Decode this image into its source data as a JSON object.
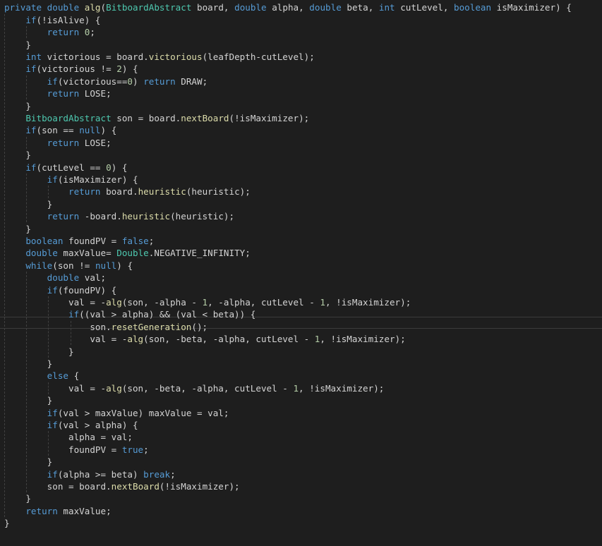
{
  "editor": {
    "language": "java",
    "colors": {
      "background": "#1e1e1e",
      "keyword": "#569cd6",
      "type": "#4ec9b0",
      "function": "#dcdcaa",
      "number": "#b5cea8",
      "text": "#d4d4d4"
    },
    "lines": [
      [
        [
          "kw",
          "private"
        ],
        [
          "t",
          " "
        ],
        [
          "kw",
          "double"
        ],
        [
          "t",
          " "
        ],
        [
          "fn",
          "alg"
        ],
        [
          "t",
          "("
        ],
        [
          "type",
          "BitboardAbstract"
        ],
        [
          "t",
          " board, "
        ],
        [
          "kw",
          "double"
        ],
        [
          "t",
          " alpha, "
        ],
        [
          "kw",
          "double"
        ],
        [
          "t",
          " beta, "
        ],
        [
          "kw",
          "int"
        ],
        [
          "t",
          " cutLevel, "
        ],
        [
          "kw",
          "boolean"
        ],
        [
          "t",
          " isMaximizer) {"
        ]
      ],
      [
        [
          "t",
          "    "
        ],
        [
          "kw",
          "if"
        ],
        [
          "t",
          "(!isAlive) {"
        ]
      ],
      [
        [
          "t",
          "        "
        ],
        [
          "kw",
          "return"
        ],
        [
          "t",
          " "
        ],
        [
          "num",
          "0"
        ],
        [
          "t",
          ";"
        ]
      ],
      [
        [
          "t",
          "    }"
        ]
      ],
      [
        [
          "t",
          "    "
        ],
        [
          "kw",
          "int"
        ],
        [
          "t",
          " victorious = board."
        ],
        [
          "fn",
          "victorious"
        ],
        [
          "t",
          "(leafDepth-cutLevel);"
        ]
      ],
      [
        [
          "t",
          "    "
        ],
        [
          "kw",
          "if"
        ],
        [
          "t",
          "(victorious != "
        ],
        [
          "num",
          "2"
        ],
        [
          "t",
          ") {"
        ]
      ],
      [
        [
          "t",
          "        "
        ],
        [
          "kw",
          "if"
        ],
        [
          "t",
          "(victorious=="
        ],
        [
          "num",
          "0"
        ],
        [
          "t",
          ") "
        ],
        [
          "kw",
          "return"
        ],
        [
          "t",
          " DRAW;"
        ]
      ],
      [
        [
          "t",
          "        "
        ],
        [
          "kw",
          "return"
        ],
        [
          "t",
          " LOSE;"
        ]
      ],
      [
        [
          "t",
          "    }"
        ]
      ],
      [
        [
          "t",
          "    "
        ],
        [
          "type",
          "BitboardAbstract"
        ],
        [
          "t",
          " son = board."
        ],
        [
          "fn",
          "nextBoard"
        ],
        [
          "t",
          "(!isMaximizer);"
        ]
      ],
      [
        [
          "t",
          "    "
        ],
        [
          "kw",
          "if"
        ],
        [
          "t",
          "(son == "
        ],
        [
          "kw",
          "null"
        ],
        [
          "t",
          ") {"
        ]
      ],
      [
        [
          "t",
          "        "
        ],
        [
          "kw",
          "return"
        ],
        [
          "t",
          " LOSE;"
        ]
      ],
      [
        [
          "t",
          "    }"
        ]
      ],
      [
        [
          "t",
          "    "
        ],
        [
          "kw",
          "if"
        ],
        [
          "t",
          "(cutLevel == "
        ],
        [
          "num",
          "0"
        ],
        [
          "t",
          ") {"
        ]
      ],
      [
        [
          "t",
          "        "
        ],
        [
          "kw",
          "if"
        ],
        [
          "t",
          "(isMaximizer) {"
        ]
      ],
      [
        [
          "t",
          "            "
        ],
        [
          "kw",
          "return"
        ],
        [
          "t",
          " board."
        ],
        [
          "fn",
          "heuristic"
        ],
        [
          "t",
          "(heuristic);"
        ]
      ],
      [
        [
          "t",
          "        }"
        ]
      ],
      [
        [
          "t",
          "        "
        ],
        [
          "kw",
          "return"
        ],
        [
          "t",
          " -board."
        ],
        [
          "fn",
          "heuristic"
        ],
        [
          "t",
          "(heuristic);"
        ]
      ],
      [
        [
          "t",
          "    }"
        ]
      ],
      [
        [
          "t",
          "    "
        ],
        [
          "kw",
          "boolean"
        ],
        [
          "t",
          " foundPV = "
        ],
        [
          "kw",
          "false"
        ],
        [
          "t",
          ";"
        ]
      ],
      [
        [
          "t",
          "    "
        ],
        [
          "kw",
          "double"
        ],
        [
          "t",
          " maxValue= "
        ],
        [
          "type",
          "Double"
        ],
        [
          "t",
          ".NEGATIVE_INFINITY;"
        ]
      ],
      [
        [
          "t",
          "    "
        ],
        [
          "kw",
          "while"
        ],
        [
          "t",
          "(son != "
        ],
        [
          "kw",
          "null"
        ],
        [
          "t",
          ") {"
        ]
      ],
      [
        [
          "t",
          "        "
        ],
        [
          "kw",
          "double"
        ],
        [
          "t",
          " val;"
        ]
      ],
      [
        [
          "t",
          "        "
        ],
        [
          "kw",
          "if"
        ],
        [
          "t",
          "(foundPV) {"
        ]
      ],
      [
        [
          "t",
          "            val = -"
        ],
        [
          "fn",
          "alg"
        ],
        [
          "t",
          "(son, -alpha - "
        ],
        [
          "num",
          "1"
        ],
        [
          "t",
          ", -alpha, cutLevel - "
        ],
        [
          "num",
          "1"
        ],
        [
          "t",
          ", !isMaximizer);"
        ]
      ],
      [
        [
          "t",
          "            "
        ],
        [
          "kw",
          "if"
        ],
        [
          "t",
          "((val > alpha) && (val < beta)) {"
        ]
      ],
      [
        [
          "t",
          "                son."
        ],
        [
          "fn",
          "resetGeneration"
        ],
        [
          "t",
          "();"
        ]
      ],
      [
        [
          "t",
          "                val = -"
        ],
        [
          "fn",
          "alg"
        ],
        [
          "t",
          "(son, -beta, -alpha, cutLevel - "
        ],
        [
          "num",
          "1"
        ],
        [
          "t",
          ", !isMaximizer);"
        ]
      ],
      [
        [
          "t",
          "            }"
        ]
      ],
      [
        [
          "t",
          "        }"
        ]
      ],
      [
        [
          "t",
          "        "
        ],
        [
          "kw",
          "else"
        ],
        [
          "t",
          " {"
        ]
      ],
      [
        [
          "t",
          "            val = -"
        ],
        [
          "fn",
          "alg"
        ],
        [
          "t",
          "(son, -beta, -alpha, cutLevel - "
        ],
        [
          "num",
          "1"
        ],
        [
          "t",
          ", !isMaximizer);"
        ]
      ],
      [
        [
          "t",
          "        }"
        ]
      ],
      [
        [
          "t",
          "        "
        ],
        [
          "kw",
          "if"
        ],
        [
          "t",
          "(val > maxValue) maxValue = val;"
        ]
      ],
      [
        [
          "t",
          "        "
        ],
        [
          "kw",
          "if"
        ],
        [
          "t",
          "(val > alpha) {"
        ]
      ],
      [
        [
          "t",
          "            alpha = val;"
        ]
      ],
      [
        [
          "t",
          "            foundPV = "
        ],
        [
          "kw",
          "true"
        ],
        [
          "t",
          ";"
        ]
      ],
      [
        [
          "t",
          "        }"
        ]
      ],
      [
        [
          "t",
          "        "
        ],
        [
          "kw",
          "if"
        ],
        [
          "t",
          "(alpha >= beta) "
        ],
        [
          "kw",
          "break"
        ],
        [
          "t",
          ";"
        ]
      ],
      [
        [
          "t",
          "        son = board."
        ],
        [
          "fn",
          "nextBoard"
        ],
        [
          "t",
          "(!isMaximizer);"
        ]
      ],
      [
        [
          "t",
          "    }"
        ]
      ],
      [
        [
          "t",
          "    "
        ],
        [
          "kw",
          "return"
        ],
        [
          "t",
          " maxValue;"
        ]
      ],
      [
        [
          "t",
          "}"
        ]
      ]
    ]
  }
}
